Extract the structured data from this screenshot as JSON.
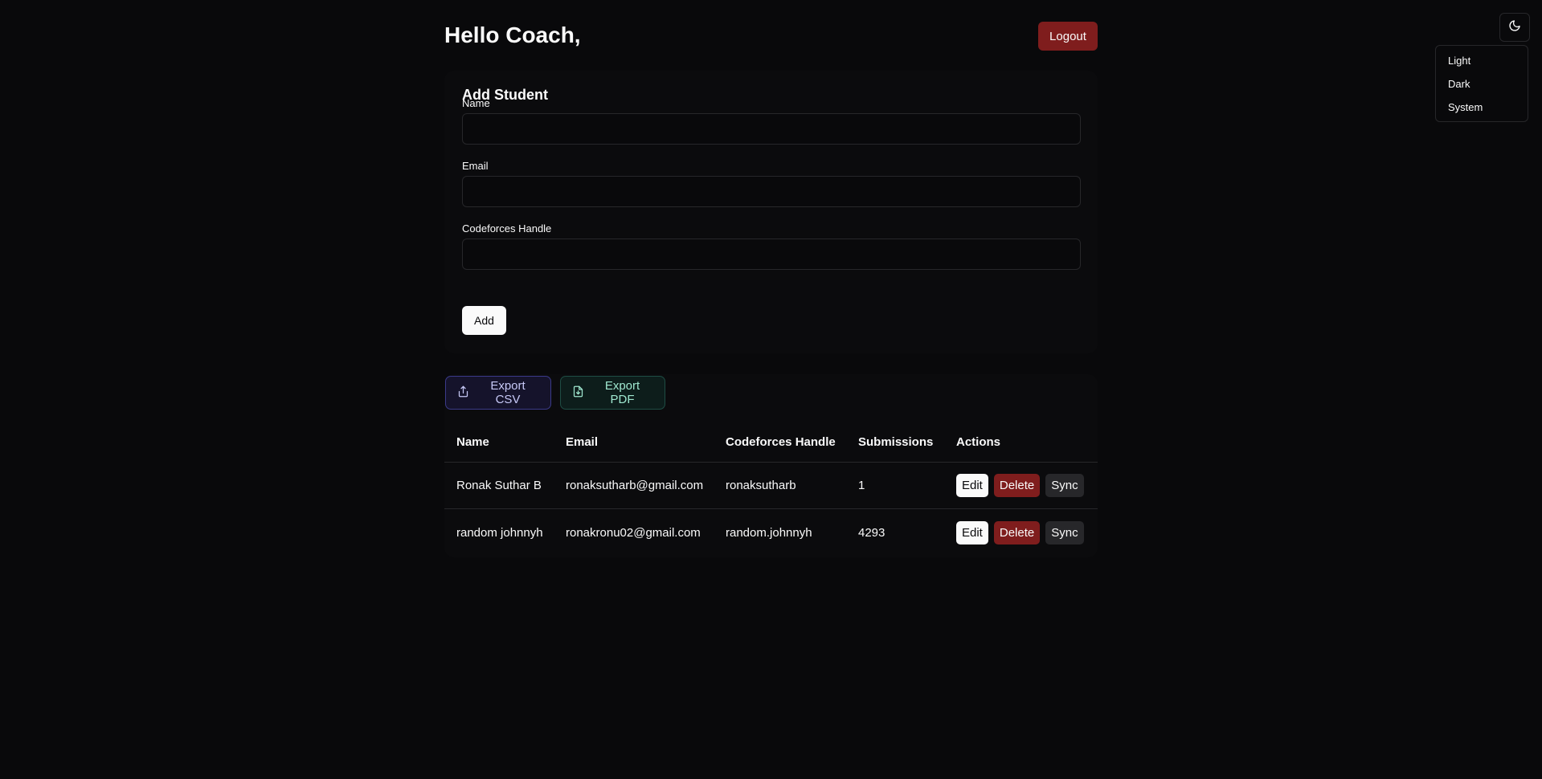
{
  "header": {
    "greeting": "Hello Coach,",
    "logout_label": "Logout"
  },
  "theme": {
    "toggle_icon": "moon-icon",
    "options": [
      "Light",
      "Dark",
      "System"
    ]
  },
  "add_student": {
    "title": "Add Student",
    "fields": [
      {
        "label": "Name",
        "value": "",
        "placeholder": ""
      },
      {
        "label": "Email",
        "value": "",
        "placeholder": ""
      },
      {
        "label": "Codeforces Handle",
        "value": "",
        "placeholder": ""
      }
    ],
    "submit_label": "Add"
  },
  "exports": {
    "csv_label": "Export CSV",
    "pdf_label": "Export PDF"
  },
  "table": {
    "columns": [
      "Name",
      "Email",
      "Codeforces Handle",
      "Submissions",
      "Actions"
    ],
    "rows": [
      {
        "name": "Ronak Suthar B",
        "email": "ronaksutharb@gmail.com",
        "handle": "ronaksutharb",
        "submissions": "1"
      },
      {
        "name": "random johnnyh",
        "email": "ronakronu02@gmail.com",
        "handle": "random.johnnyh",
        "submissions": "4293"
      }
    ],
    "actions": {
      "edit": "Edit",
      "delete": "Delete",
      "sync": "Sync"
    }
  },
  "colors": {
    "background": "#09090b",
    "danger": "#7f1d1d",
    "border": "#27272a"
  }
}
